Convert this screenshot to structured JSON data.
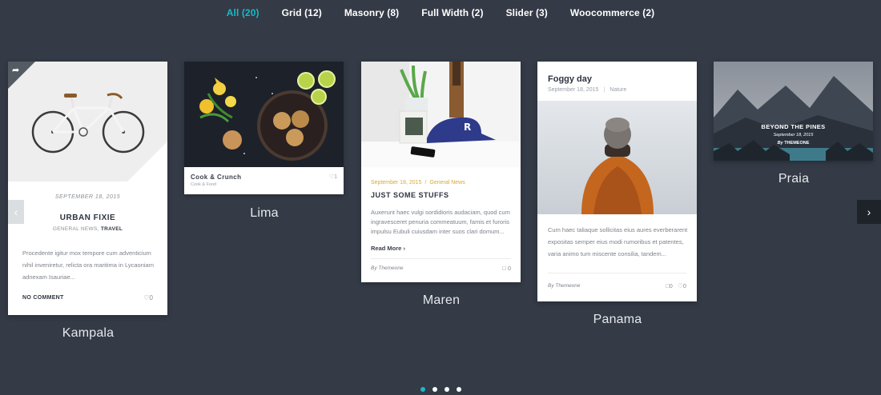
{
  "filters": [
    {
      "label": "All (20)",
      "active": true
    },
    {
      "label": "Grid (12)",
      "active": false
    },
    {
      "label": "Masonry (8)",
      "active": false
    },
    {
      "label": "Full Width (2)",
      "active": false
    },
    {
      "label": "Slider (3)",
      "active": false
    },
    {
      "label": "Woocommerce (2)",
      "active": false
    }
  ],
  "cards": {
    "kampala": {
      "date": "SEPTEMBER 18, 2015",
      "title": "URBAN FIXIE",
      "cat1": "GENERAL NEWS,",
      "cat2": "TRAVEL",
      "excerpt": "Procedente igitur mox tempore cum adventicium nihil inveniretur, relicta ora maritima in Lycaoniam adnexam Isauriae...",
      "comment_label": "NO COMMENT",
      "likes": "0",
      "caption": "Kampala"
    },
    "lima": {
      "title": "Cook & Crunch",
      "sub": "Cook & Food",
      "likes": "1",
      "caption": "Lima"
    },
    "maren": {
      "date": "September 18, 2015",
      "category": "General News",
      "title": "JUST SOME STUFFS",
      "excerpt": "Auxerunt haec vulgi sordidioris audaciam, quod cum ingravesceret penuria commeatuum, famis et furoris impulsu Eubuli cuiusdam inter suos clari domum...",
      "readmore": "Read More",
      "byline_prefix": "By",
      "byline_author": "Themeone",
      "comments": "0",
      "caption": "Maren"
    },
    "panama": {
      "title": "Foggy day",
      "date": "September 18, 2015",
      "category": "Nature",
      "excerpt": "Cum haec taliaque sollicitas eius aures everberarent expositas semper eius modi rumoribus et patentes, varia animo tum miscente consilia, tandem...",
      "byline_prefix": "By",
      "byline_author": "Themeone",
      "comments": "0",
      "likes": "0",
      "caption": "Panama"
    },
    "praia": {
      "title": "BEYOND THE PINES",
      "date": "September 18, 2015",
      "author_prefix": "By",
      "author": "THEMEONE",
      "caption": "Praia"
    }
  },
  "icons": {
    "share": "share-icon",
    "heart": "heart-icon",
    "comment": "comment-icon",
    "prev": "chevron-left-icon",
    "next": "chevron-right-icon"
  },
  "colors": {
    "accent": "#18b9c9",
    "background": "#343a46",
    "category_gold": "#d9a737"
  },
  "pagination": {
    "count": 4,
    "active": 1
  }
}
